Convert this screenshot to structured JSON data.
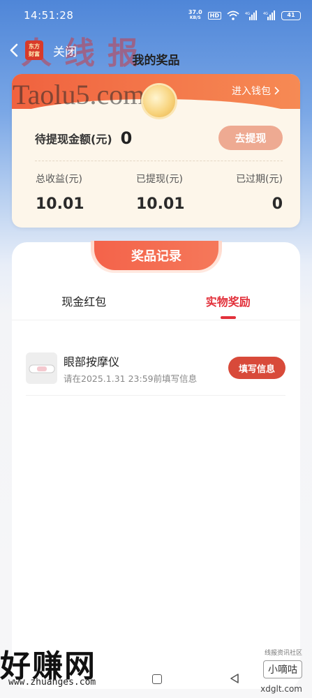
{
  "status_bar": {
    "time": "14:51:28",
    "net_speed_value": "37.0",
    "net_speed_unit": "KB/S",
    "hd_label": "HD",
    "signal_label_1": "4G",
    "signal_label_2": "4G",
    "battery": "41"
  },
  "nav": {
    "logo_line1": "东方",
    "logo_line2": "财富",
    "close_label": "关闭",
    "title": "我的奖品"
  },
  "watermarks": {
    "top_cn": "人线报",
    "site": "Taolu5.com",
    "bottom_cn": "好赚网",
    "bottom_url": "www.zhuanges.com",
    "small_badge": "小嘀咕",
    "small_caption": "线报资讯社区",
    "domain": "xdglt.com"
  },
  "wallet": {
    "enter_wallet": "进入钱包",
    "pending_label": "待提现金额(元)",
    "pending_value": "0",
    "withdraw_button": "去提现",
    "stats": {
      "total_label": "总收益(元)",
      "total_value": "10.01",
      "withdrawn_label": "已提现(元)",
      "withdrawn_value": "10.01",
      "expired_label": "已过期(元)",
      "expired_value": "0"
    }
  },
  "records": {
    "title": "奖品记录",
    "tabs": [
      {
        "label": "现金红包",
        "active": false
      },
      {
        "label": "实物奖励",
        "active": true
      }
    ],
    "items": [
      {
        "name": "眼部按摩仪",
        "deadline": "请在2025.1.31 23:59前填写信息",
        "action": "填写信息"
      }
    ]
  },
  "colors": {
    "accent_red": "#e2303a",
    "header_orange": "#f0623f",
    "button_red": "#d84a3a",
    "withdraw_button": "#eeaa92"
  },
  "icons": {
    "back": "chevron-left-icon",
    "wallet_arrow": "chevron-right-icon",
    "coin": "coin-icon",
    "wifi": "wifi-icon",
    "home": "home-square-icon",
    "nav_back": "triangle-back-icon"
  }
}
